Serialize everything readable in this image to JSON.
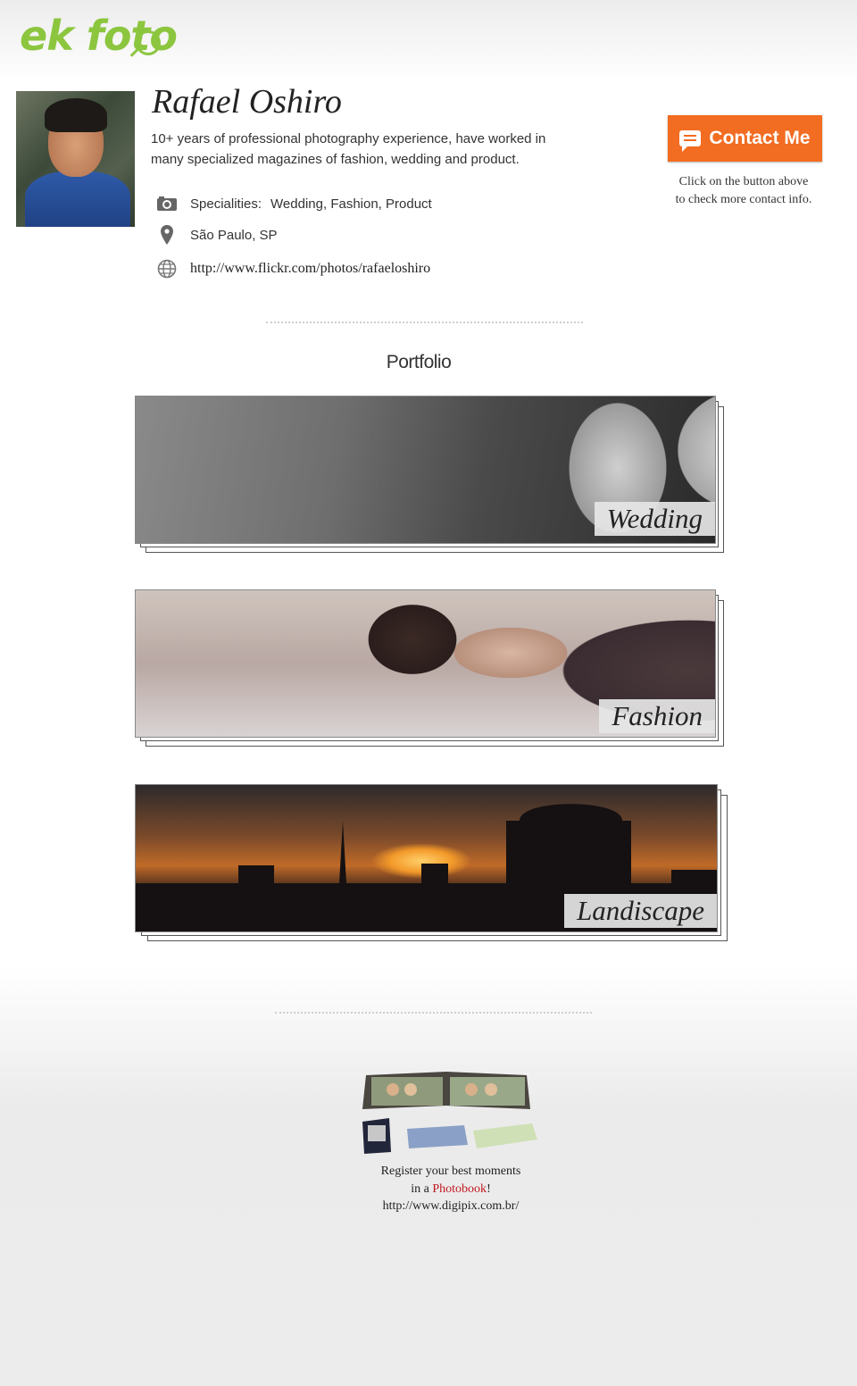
{
  "logo": {
    "text": "ek foto"
  },
  "profile": {
    "name": "Rafael Oshiro",
    "bio": "10+ years of professional photography experience, have worked in many specialized magazines of fashion, wedding and product.",
    "specialities_label": "Specialities:",
    "specialities_value": "Wedding, Fashion, Product",
    "location": "São Paulo, SP",
    "website": "http://www.flickr.com/photos/rafaeloshiro"
  },
  "contact": {
    "button_label": "Contact Me",
    "note_line1": "Click on the button above",
    "note_line2": "to check more contact info."
  },
  "portfolio": {
    "title": "Portfolio",
    "items": [
      {
        "label": "Wedding"
      },
      {
        "label": "Fashion"
      },
      {
        "label": "Landiscape"
      }
    ]
  },
  "footer": {
    "line1": "Register your best moments",
    "line2_prefix": "in a ",
    "line2_highlight": "Photobook",
    "line2_suffix": "!",
    "url": "http://www.digipix.com.br/"
  },
  "colors": {
    "accent_green": "#8cc63f",
    "button_orange": "#f26c21",
    "highlight_red": "#c0171e"
  }
}
